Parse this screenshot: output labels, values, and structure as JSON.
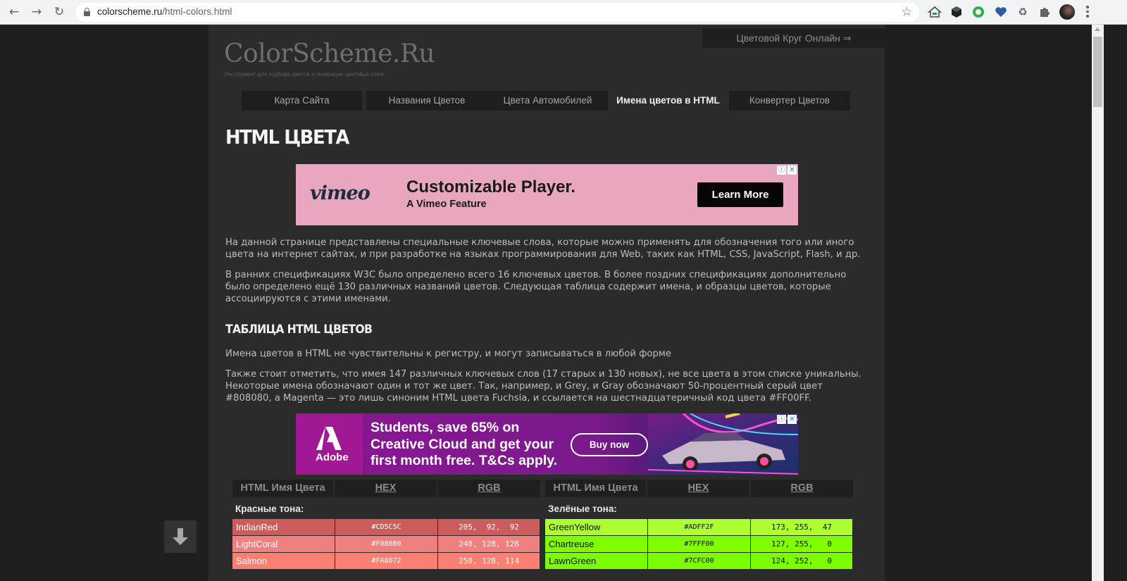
{
  "browser": {
    "url_host": "colorscheme.ru",
    "url_path": "/html-colors.html",
    "extensions": [
      "home-extension-icon",
      "cube-extension-icon",
      "circle-extension-icon",
      "heart-extension-icon",
      "recycle-extension-icon",
      "puzzle-extension-icon"
    ]
  },
  "site": {
    "wheel_link": "Цветовой Круг Онлайн ⇒",
    "logo": "ColorScheme.Ru",
    "tagline": "- Инструмент для подбора цветов и генерации цветовых схем -"
  },
  "menu": [
    {
      "label": "Карта Сайта"
    },
    {
      "label": "Названия Цветов"
    },
    {
      "label": "Цвета Автомобилей"
    },
    {
      "label": "Имена цветов в HTML"
    },
    {
      "label": "Конвертер Цветов"
    }
  ],
  "page": {
    "title": "HTML ЦВЕТА",
    "para1": "На данной странице представлены специальные ключевые слова, которые можно применять для обозначения того или иного цвета на интернет сайтах, и при разработке на языках программирования для Web, таких как HTML, CSS, JavaScript, Flash, и др.",
    "para2": "В ранних спецификациях W3C было определено всего 16 ключевых цветов. В более поздних спецификациях дополнительно было определено ещё 130 различных названий цветов. Следующая таблица содержит имена, и образцы цветов, которые ассоциируются с этими именами.",
    "subtitle": "ТАБЛИЦА HTML ЦВЕТОВ",
    "para3": "Имена цветов в HTML не чувствительны к регистру, и могут записываться в любой форме",
    "para4": "Также стоит отметить, что имея 147 различных ключевых слов (17 старых и 130 новых), не все цвета в этом списке уникальны. Некоторые имена обозначают один и тот же цвет. Так, например, и Grey, и Gray обозначают 50-процентный серый цвет #808080, а Magenta — это лишь синоним HTML цвета Fuchsia, и ссылается на шестнадцатеричный код цвета #FF00FF."
  },
  "ads": {
    "vimeo": {
      "logo": "vimeo",
      "headline": "Customizable Player.",
      "sub": "A Vimeo Feature",
      "button": "Learn More"
    },
    "adobe": {
      "logo": "Adobe",
      "copy": "Students, save 65% on Creative Cloud and get your first month free. T&Cs apply.",
      "button": "Buy now"
    },
    "choices_info": "ⓘ",
    "choices_close": "✕"
  },
  "table_headers": {
    "name": "HTML Имя Цвета",
    "hex": "HEX",
    "rgb": "RGB"
  },
  "tables": [
    {
      "group": "Красные тона:",
      "rows": [
        {
          "name": "IndianRed",
          "hex": "#CD5C5C",
          "rgb": "205,  92,  92",
          "color": "#CD5C5C"
        },
        {
          "name": "LightCoral",
          "hex": "#F08080",
          "rgb": "240, 128, 128",
          "color": "#F08080"
        },
        {
          "name": "Salmon",
          "hex": "#FA8072",
          "rgb": "250, 128, 114",
          "color": "#FA8072"
        }
      ]
    },
    {
      "group": "Зелёные тона:",
      "rows": [
        {
          "name": "GreenYellow",
          "hex": "#ADFF2F",
          "rgb": "173, 255,  47",
          "color": "#ADFF2F"
        },
        {
          "name": "Chartreuse",
          "hex": "#7FFF00",
          "rgb": "127, 255,   0",
          "color": "#7FFF00"
        },
        {
          "name": "LawnGreen",
          "hex": "#7CFC00",
          "rgb": "124, 252,   0",
          "color": "#7CFC00"
        }
      ]
    }
  ]
}
